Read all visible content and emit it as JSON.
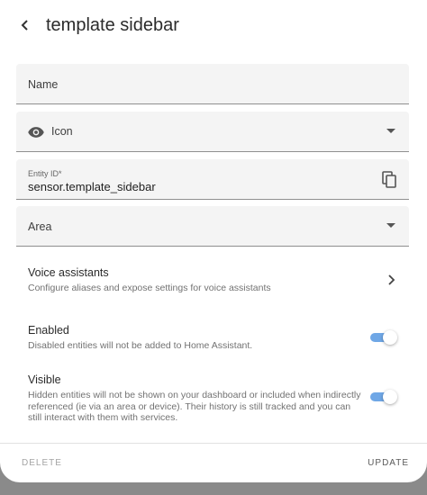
{
  "dialog": {
    "title": "template sidebar"
  },
  "fields": {
    "name_label": "Name",
    "icon_label": "Icon",
    "entity_id_label": "Entity ID*",
    "entity_id_value": "sensor.template_sidebar",
    "area_label": "Area"
  },
  "voice": {
    "title": "Voice assistants",
    "subtitle": "Configure aliases and expose settings for voice assistants"
  },
  "enabled": {
    "title": "Enabled",
    "subtitle": "Disabled entities will not be added to Home Assistant.",
    "on": true
  },
  "visible": {
    "title": "Visible",
    "subtitle": "Hidden entities will not be shown on your dashboard or included when indirectly referenced (ie via an area or device). Their history is still tracked and you can still interact with them with services.",
    "on": true
  },
  "footer": {
    "delete_label": "DELETE",
    "update_label": "UPDATE"
  },
  "icons": {
    "back": "arrow-left-icon",
    "eye": "eye-icon",
    "copy": "copy-icon",
    "dropdown": "dropdown-arrow-icon",
    "chevron": "chevron-right-icon"
  },
  "colors": {
    "toggle_on": "#6fa7e6",
    "field_bg": "#f4f4f4",
    "backdrop": "#8a8a8a"
  }
}
